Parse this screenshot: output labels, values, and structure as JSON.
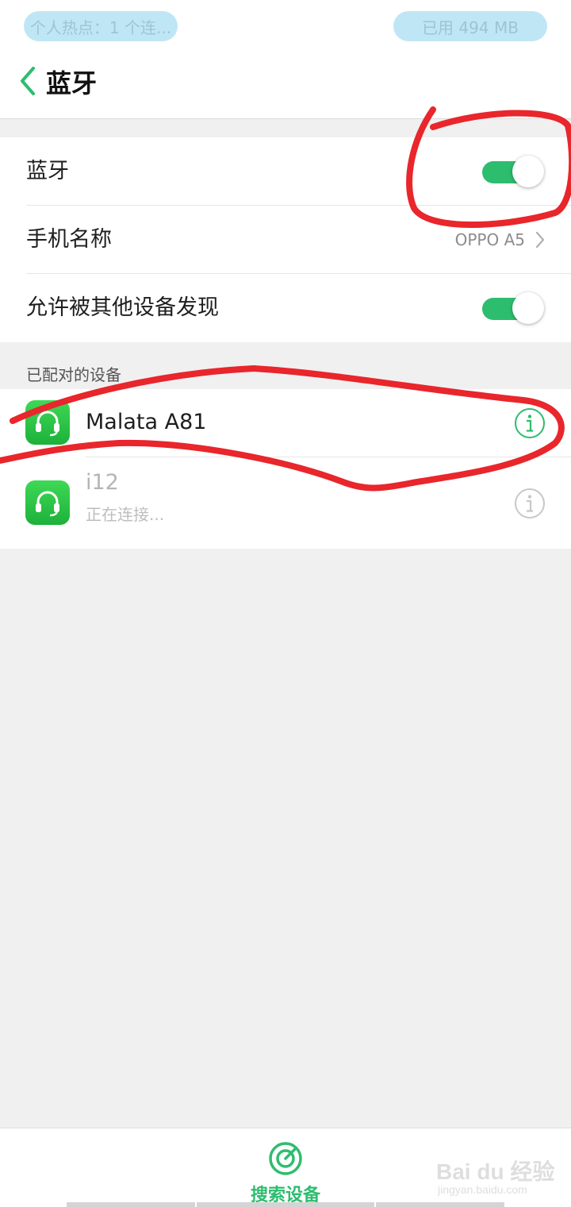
{
  "status_bar": {
    "hotspot_text": "个人热点：1 个连...",
    "memory_text": "已用 494 MB"
  },
  "header": {
    "title": "蓝牙",
    "back_icon": "chevron-left-icon"
  },
  "settings": {
    "bluetooth": {
      "label": "蓝牙",
      "enabled": true
    },
    "device_name": {
      "label": "手机名称",
      "value": "OPPO A5"
    },
    "discoverable": {
      "label": "允许被其他设备发现",
      "enabled": true
    }
  },
  "paired": {
    "header": "已配对的设备",
    "devices": [
      {
        "name": "Malata A81",
        "status": "",
        "icon": "headset-icon",
        "info_icon": "info-icon",
        "active": true
      },
      {
        "name": "i12",
        "status": "正在连接...",
        "icon": "headset-icon",
        "info_icon": "info-icon",
        "active": false
      }
    ]
  },
  "bottom": {
    "search_label": "搜索设备",
    "search_icon": "radar-search-icon"
  },
  "watermark": {
    "main": "Bai du 经验",
    "sub": "jingyan.baidu.com"
  },
  "colors": {
    "accent": "#2dbd6e",
    "annotation": "#e8262b",
    "device_icon": "#26c244"
  }
}
